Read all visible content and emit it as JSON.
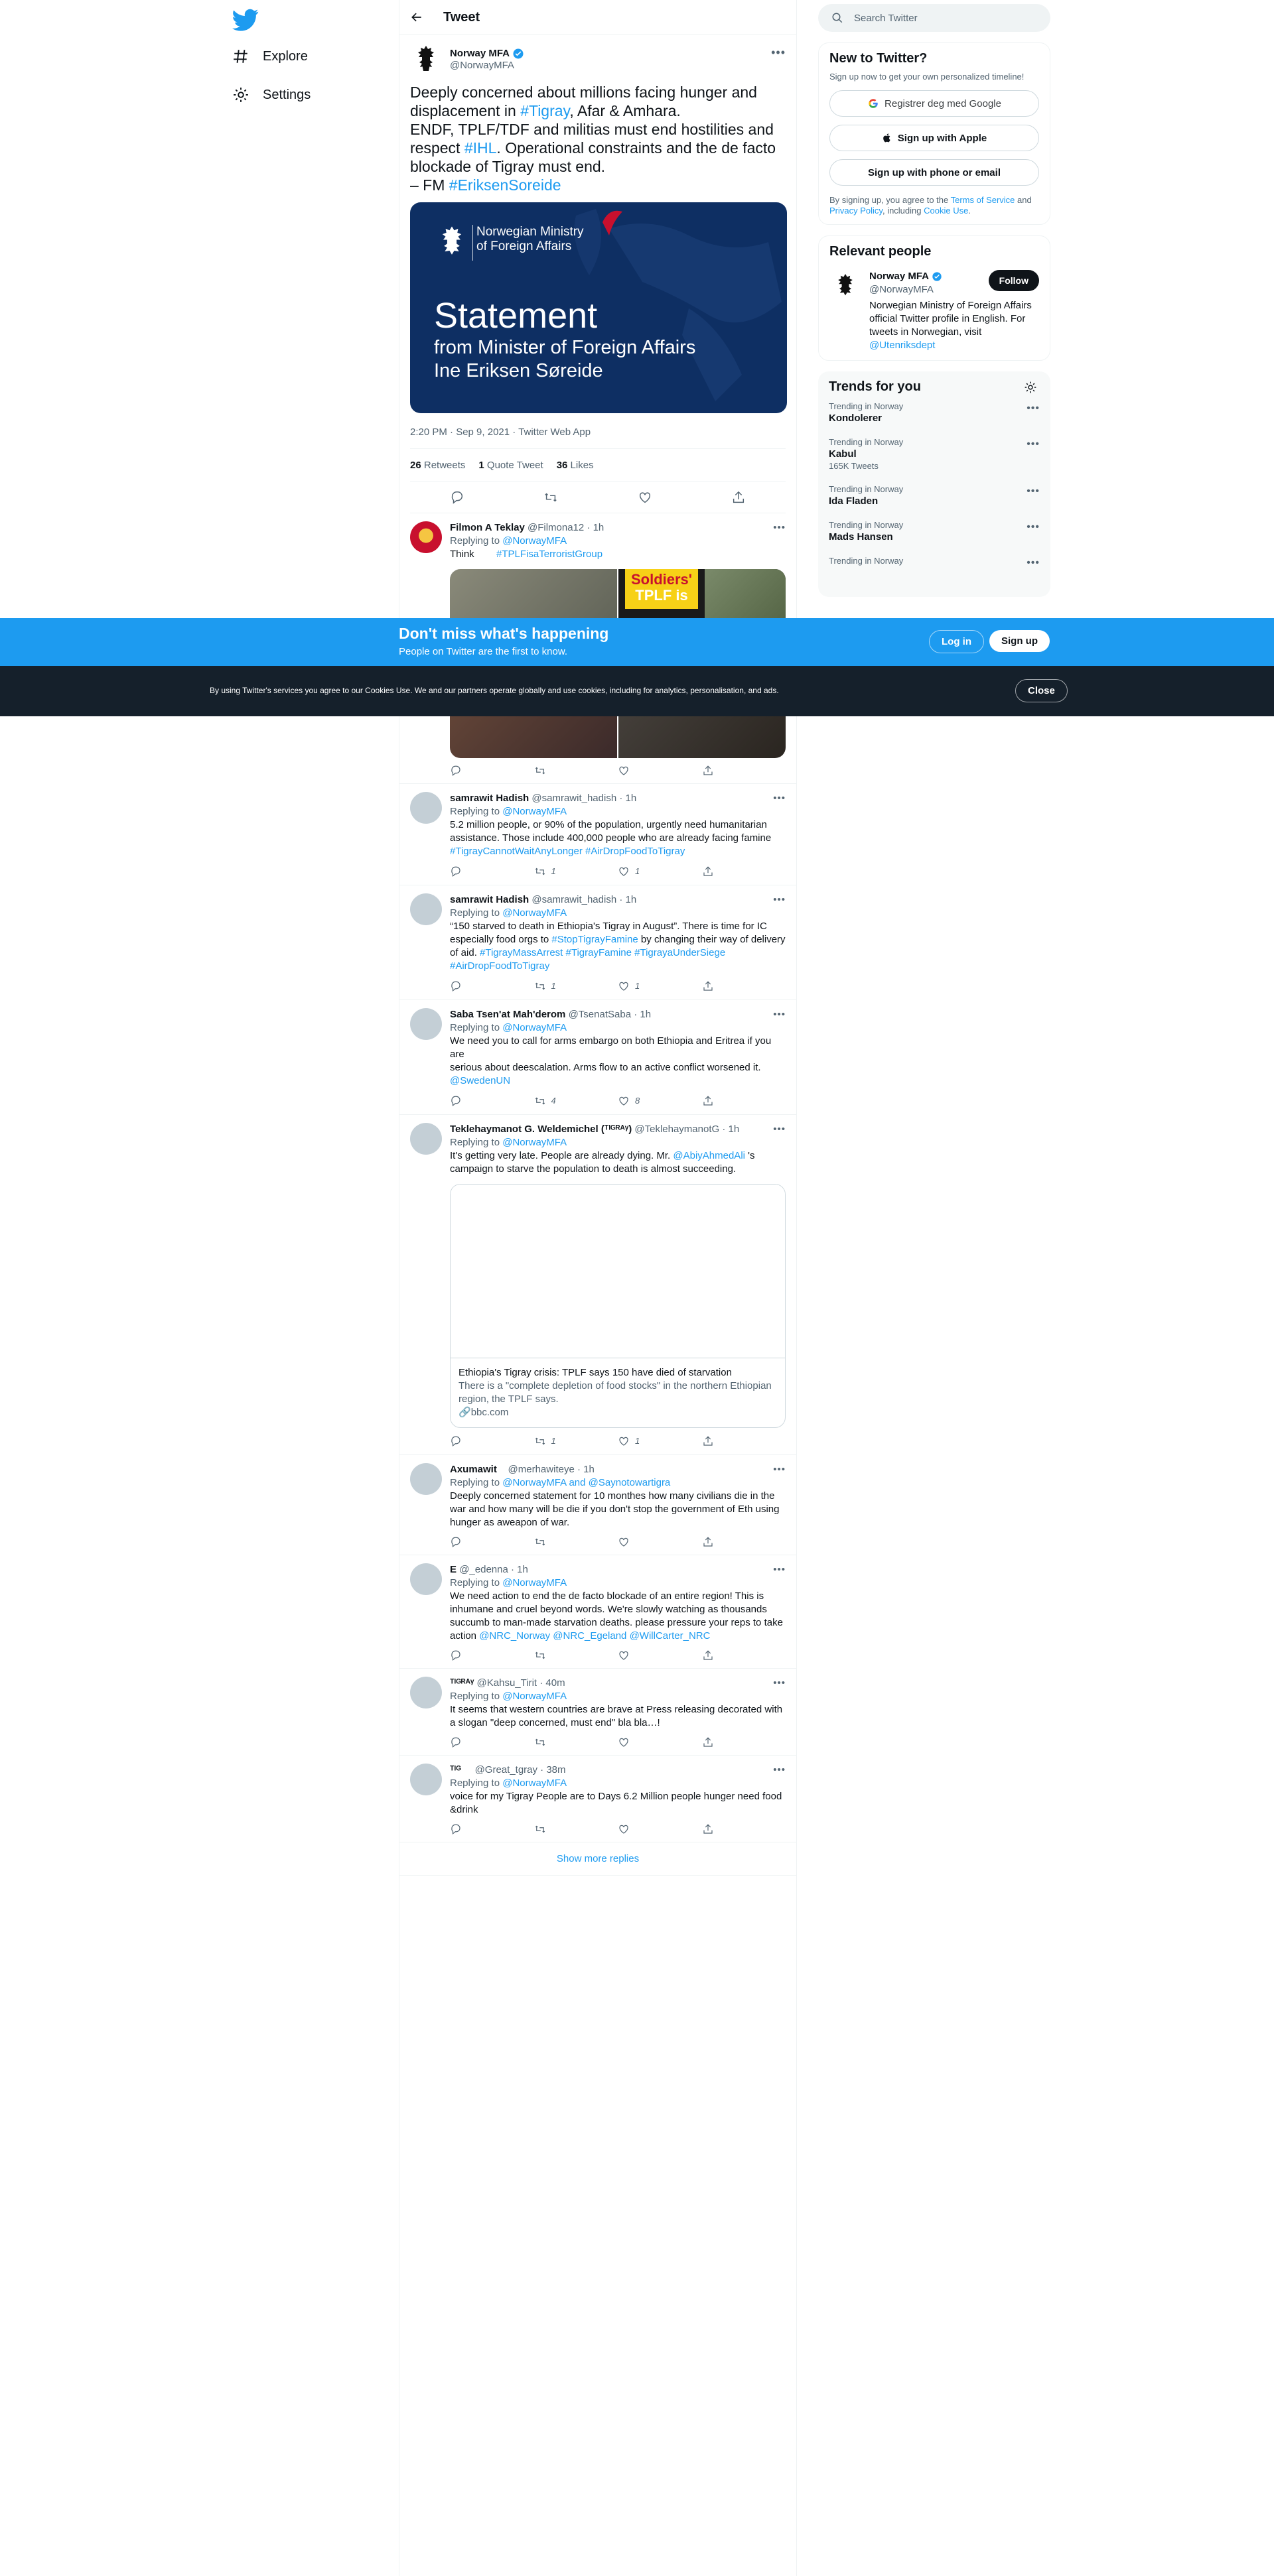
{
  "nav": {
    "explore": "Explore",
    "settings": "Settings"
  },
  "header": {
    "title": "Tweet"
  },
  "main_tweet": {
    "name": "Norway MFA",
    "handle": "@NorwayMFA",
    "text_l1a": "Deeply concerned about millions facing hunger and",
    "text_l2a": "displacement in ",
    "text_l2b": "#Tigray",
    "text_l2c": ", Afar & Amhara.",
    "text_l3": "ENDF, TPLF/TDF and militias must end hostilities and",
    "text_l4a": "respect ",
    "text_l4b": "#IHL",
    "text_l4c": ". Operational constraints and the de facto",
    "text_l5": "blockade of Tigray must end.",
    "text_l6a": "– FM ",
    "text_l6b": "#EriksenSoreide",
    "card_ministry_1": "Norwegian Ministry",
    "card_ministry_2": "of Foreign Affairs",
    "card_title": "Statement",
    "card_sub_1": "from Minister of Foreign Affairs",
    "card_sub_2": "Ine Eriksen Søreide",
    "meta": "2:20 PM · Sep 9, 2021 · Twitter Web App",
    "retweets_n": "26",
    "retweets_l": "Retweets",
    "quotes_n": "1",
    "quotes_l": "Quote Tweet",
    "likes_n": "36",
    "likes_l": "Likes"
  },
  "replies": [
    {
      "name": "Filmon A Teklay",
      "meta": "@Filmona12 · 1h",
      "replying": "Replying to ",
      "replying_to": "@NorwayMFA",
      "text": "Think",
      "tag": "#TPLFisaTerroristGroup",
      "rt": "",
      "like": "",
      "poster_word": "Soldiers'",
      "poster_word2": "TPLF is"
    },
    {
      "name": "samrawit Hadish",
      "meta": "@samrawit_hadish · 1h",
      "replying": "Replying to ",
      "replying_to": "@NorwayMFA",
      "text1": "5.2 million people, or 90% of the population, urgently need humanitarian",
      "text2": "assistance. Those include 400,000 people who are already facing famine",
      "tags": "#TigrayCannotWaitAnyLonger #AirDropFoodToTigray",
      "rt": "1",
      "like": "1"
    },
    {
      "name": "samrawit Hadish",
      "meta": "@samrawit_hadish · 1h",
      "replying": "Replying to ",
      "replying_to": "@NorwayMFA",
      "text1": "“150 starved to death in Ethiopia's Tigray in August”. There is time for IC",
      "text2a": "especially food orgs to ",
      "text2b": "#StopTigrayFamine",
      "text2c": " by changing their way of delivery",
      "text3a": "of aid. ",
      "text3b": "#TigrayMassArrest #TigrayFamine #TigrayaUnderSiege",
      "text4": "#AirDropFoodToTigray",
      "rt": "1",
      "like": "1"
    },
    {
      "name": "Saba Tsen'at Mah'derom",
      "meta": "@TsenatSaba · 1h",
      "replying": "Replying to ",
      "replying_to": "@NorwayMFA",
      "text1": "We need you to call for arms embargo on both Ethiopia and Eritrea if you are",
      "text2": "serious about deescalation. Arms flow to an active conflict worsened it.",
      "text3": "@SwedenUN",
      "rt": "4",
      "like": "8"
    },
    {
      "name": "Teklehaymanot G. Weldemichel (ᵀᴵᴳᴿᴬᵞ)",
      "meta": "@TeklehaymanotG · 1h",
      "replying": "Replying to ",
      "replying_to": "@NorwayMFA",
      "text1a": "It's getting very late. People are already dying. Mr. ",
      "text1b": "@AbiyAhmedAli",
      "text1c": " 's",
      "text2": "campaign to starve the population to death is almost succeeding.",
      "card_title": "Ethiopia's Tigray crisis: TPLF says 150 have died of starvation",
      "card_desc": "There is a \"complete depletion of food stocks\" in the northern Ethiopian region, the TPLF says.",
      "card_domain": "bbc.com",
      "rt": "1",
      "like": "1"
    },
    {
      "name": "Axumawit",
      "meta": "@merhawiteye · 1h",
      "replying": "Replying to ",
      "replying_to": "@NorwayMFA and @Saynotowartigra",
      "text1": "Deeply concerned statement for 10 monthes  how many civilians die in the",
      "text2": "war and how many will be die if you don't stop the government of Eth using",
      "text3": "hunger as aweapon of war.",
      "rt": "",
      "like": ""
    },
    {
      "name": "E",
      "meta": "@_edenna · 1h",
      "replying": "Replying to ",
      "replying_to": "@NorwayMFA",
      "text1": "We need action to end the de facto blockade of an entire region! This is",
      "text2": "inhumane and cruel beyond words. We're slowly watching as thousands",
      "text3": "succumb to man-made starvation deaths. please pressure your reps to take",
      "text4a": "action ",
      "text4b": "@NRC_Norway @NRC_Egeland @WillCarter_NRC",
      "rt": "",
      "like": ""
    },
    {
      "name": "ᵀᴵᴳᴿᴬᵞ",
      "meta": "@Kahsu_Tirit · 40m",
      "replying": "Replying to ",
      "replying_to": "@NorwayMFA",
      "text1": "It seems that western countries are brave at Press releasing decorated with",
      "text2": "a slogan \"deep concerned, must end\" bla bla…!",
      "rt": "",
      "like": ""
    },
    {
      "name": "ᵀᴵᴳ",
      "meta": "@Great_tgray · 38m",
      "replying": "Replying to ",
      "replying_to": "@NorwayMFA",
      "text1": "voice for my Tigray People are to Days 6.2 Million people hunger need food",
      "text2": "&drink",
      "rt": "",
      "like": ""
    }
  ],
  "show_more": "Show more replies",
  "right": {
    "search_placeholder": "Search Twitter",
    "new_title": "New to Twitter?",
    "new_sub": "Sign up now to get your own personalized timeline!",
    "google": "Registrer deg med Google",
    "apple": "Sign up with Apple",
    "phone": "Sign up with phone or email",
    "terms1": "By signing up, you agree to the ",
    "terms_link": "Terms of Service",
    "terms2": " and",
    "privacy_link": "Privacy Policy",
    "terms3": ", including ",
    "cookie_link": "Cookie Use",
    "terms4": ".",
    "relevant_title": "Relevant people",
    "rp_name": "Norway MFA",
    "rp_handle": "@NorwayMFA",
    "rp_follow": "Follow",
    "rp_bio1": "Norwegian Ministry of Foreign Affairs",
    "rp_bio2": "official Twitter profile in English. For",
    "rp_bio3": "tweets in Norwegian, visit",
    "rp_bio4": "@Utenriksdept",
    "trends_title": "Trends for you",
    "trends": [
      {
        "label": "Trending in Norway",
        "name": "Kondolerer",
        "count": ""
      },
      {
        "label": "Trending in Norway",
        "name": "Kabul",
        "count": "165K Tweets"
      },
      {
        "label": "Trending in Norway",
        "name": "Ida Fladen",
        "count": ""
      },
      {
        "label": "Trending in Norway",
        "name": "Mads Hansen",
        "count": ""
      },
      {
        "label": "Trending in Norway",
        "name": "",
        "count": ""
      }
    ]
  },
  "banner": {
    "headline": "Don't miss what's happening",
    "sub": "People on Twitter are the first to know.",
    "login": "Log in",
    "signup": "Sign up"
  },
  "cookie": {
    "text": "By using Twitter's services you agree to our Cookies Use. We and our partners operate globally and use cookies, including for analytics, personalisation, and ads.",
    "close": "Close"
  },
  "colors": {
    "accent": "#1d9bf0",
    "banner": "#1d9bf0",
    "cookie_bar": "#15202b",
    "card_navy": "#0e2f63"
  },
  "icons": [
    "twitter-logo-icon",
    "hashtag-icon",
    "gear-icon",
    "back-arrow-icon",
    "verified-icon",
    "reply-icon",
    "retweet-icon",
    "like-icon",
    "share-icon",
    "search-icon",
    "google-icon",
    "apple-icon",
    "link-icon"
  ]
}
